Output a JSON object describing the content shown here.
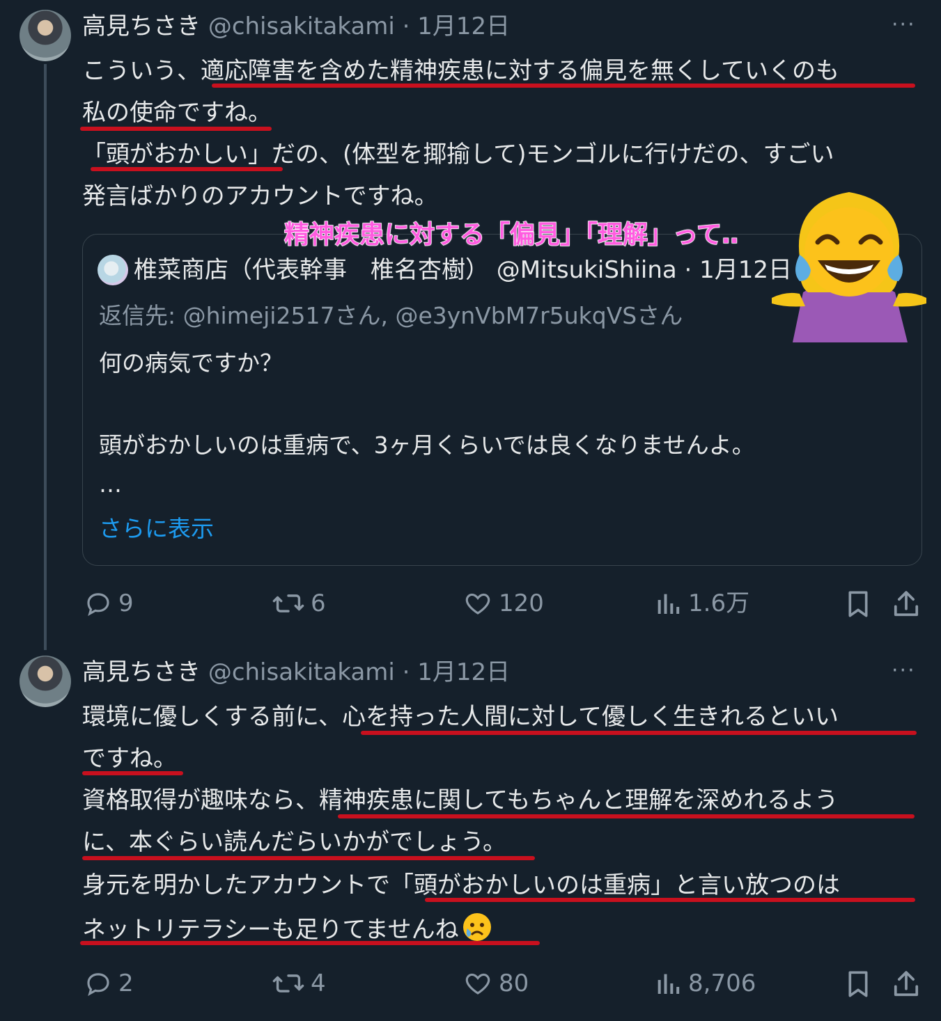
{
  "tweet1": {
    "name": "高見ちさき",
    "meta": "@chisakitakami · 1月12日",
    "more": "···",
    "lines": [
      "こういう、適応障害を含めた精神疾患に対する偏見を無くしていくのも",
      "私の使命ですね。",
      "「頭がおかしい」だの、(体型を揶揄して)モンゴルに行けだの、すごい",
      "発言ばかりのアカウントですね。"
    ],
    "quote": {
      "header": "椎菜商店（代表幹事　椎名杏樹） @MitsukiShiina · 1月12日",
      "reply_to": "返信先: @himeji2517さん, @e3ynVbM7r5ukqVSさん",
      "line1": "何の病気ですか？",
      "line2": "頭がおかしいのは重病で、3ヶ月くらいでは良くなりませんよ。",
      "ellipsis": "…",
      "show_more": "さらに表示"
    },
    "actions": {
      "replies": "9",
      "retweets": "6",
      "likes": "120",
      "views": "1.6万"
    }
  },
  "overlay": {
    "caption": "精神疾患に対する「偏見」「理解」って‥",
    "emoji_name": "woman-shrugging-tears-of-joy-emoji"
  },
  "tweet2": {
    "name": "高見ちさき",
    "meta": "@chisakitakami · 1月12日",
    "more": "···",
    "lines": [
      "環境に優しくする前に、心を持った人間に対して優しく生きれるといい",
      "ですね。",
      "資格取得が趣味なら、精神疾患に関してもちゃんと理解を深めれるよう",
      "に、本ぐらい読んだらいかがでしょう。",
      "身元を明かしたアカウントで「頭がおかしいのは重病」と言い放つのは",
      "ネットリテラシーも足りてませんね"
    ],
    "actions": {
      "replies": "2",
      "retweets": "4",
      "likes": "80",
      "views": "8,706"
    }
  },
  "colors": {
    "background": "#15202b",
    "text": "#e7e9ea",
    "muted": "#8b98a5",
    "link": "#1d9bf0",
    "underline": "#c8101e",
    "overlay": "#ff5ce0"
  }
}
